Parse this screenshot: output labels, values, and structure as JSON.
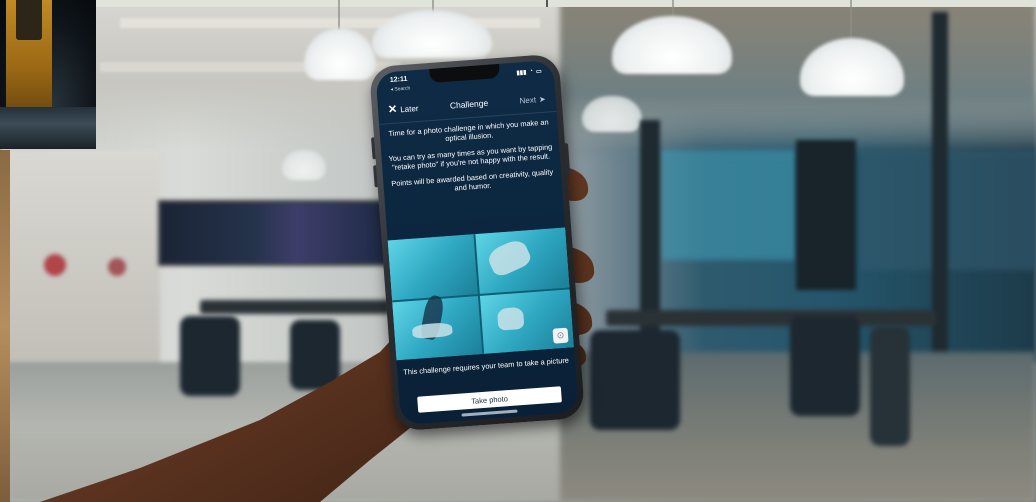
{
  "phone": {
    "status_time": "12:11",
    "back_app": "◂ Search",
    "nav": {
      "later_label": "Later",
      "title": "Challenge",
      "next_label": "Next"
    },
    "intro_paragraphs": [
      "Time for a photo challenge in which you make an optical illusion.",
      "You can try as many times as you want by  tapping \"retake photo\" if you're not happy with the result.",
      "Points will be awarded based on creativity, quality and humor."
    ],
    "requirement_text": "This challenge requires your team to take a picture",
    "take_photo_label": "Take photo",
    "icons": {
      "close": "close-icon",
      "next": "arrow-right-icon",
      "info": "info-icon"
    }
  },
  "colors": {
    "screen_bg": "#0c2740",
    "photo_accent": "#2fb5cf",
    "button_bg": "#ffffff"
  }
}
